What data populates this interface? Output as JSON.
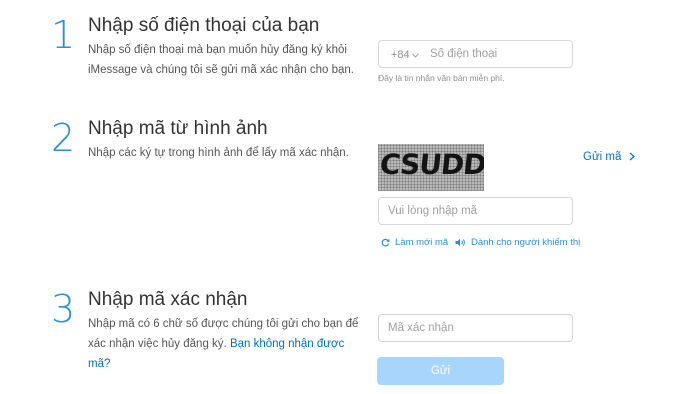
{
  "step1": {
    "number": "1",
    "title": "Nhập số điện thoại của bạn",
    "desc_line1": "Nhập số điện thoại mà bạn muốn hủy đăng ký khỏi",
    "desc_line2": "iMessage và chúng tôi sẽ gửi mã xác nhận cho bạn.",
    "country_code": "+84",
    "phone_placeholder": "Số điện thoại",
    "hint": "Đây là tin nhắn văn bản miễn phí."
  },
  "step2": {
    "number": "2",
    "title": "Nhập mã từ hình ảnh",
    "desc": "Nhập các ký tự trong hình ảnh để lấy mã xác nhận.",
    "captcha_text": "CSUDD",
    "code_placeholder": "Vui lòng nhập mã",
    "send_code_label": "Gửi mã",
    "refresh_label": "Làm mới mã",
    "accessibility_label": "Dành cho người khiếm thị"
  },
  "step3": {
    "number": "3",
    "title": "Nhập mã xác nhận",
    "desc_line1": "Nhập mã có 6 chữ số được chúng tôi gửi cho bạn để",
    "desc_line2_prefix": "xác nhận việc hủy đăng ký.",
    "desc_link": "Bạn không nhận được mã?",
    "confirm_placeholder": "Mã xác nhận",
    "submit_label": "Gửi"
  },
  "colors": {
    "accent": "#2d8fd5",
    "link": "#0070c9",
    "button_disabled": "#a7d5fc"
  },
  "icons": {
    "dropdown": "chevron-down-icon",
    "send": "chevron-right-icon",
    "refresh": "refresh-icon",
    "audio": "speaker-icon"
  }
}
